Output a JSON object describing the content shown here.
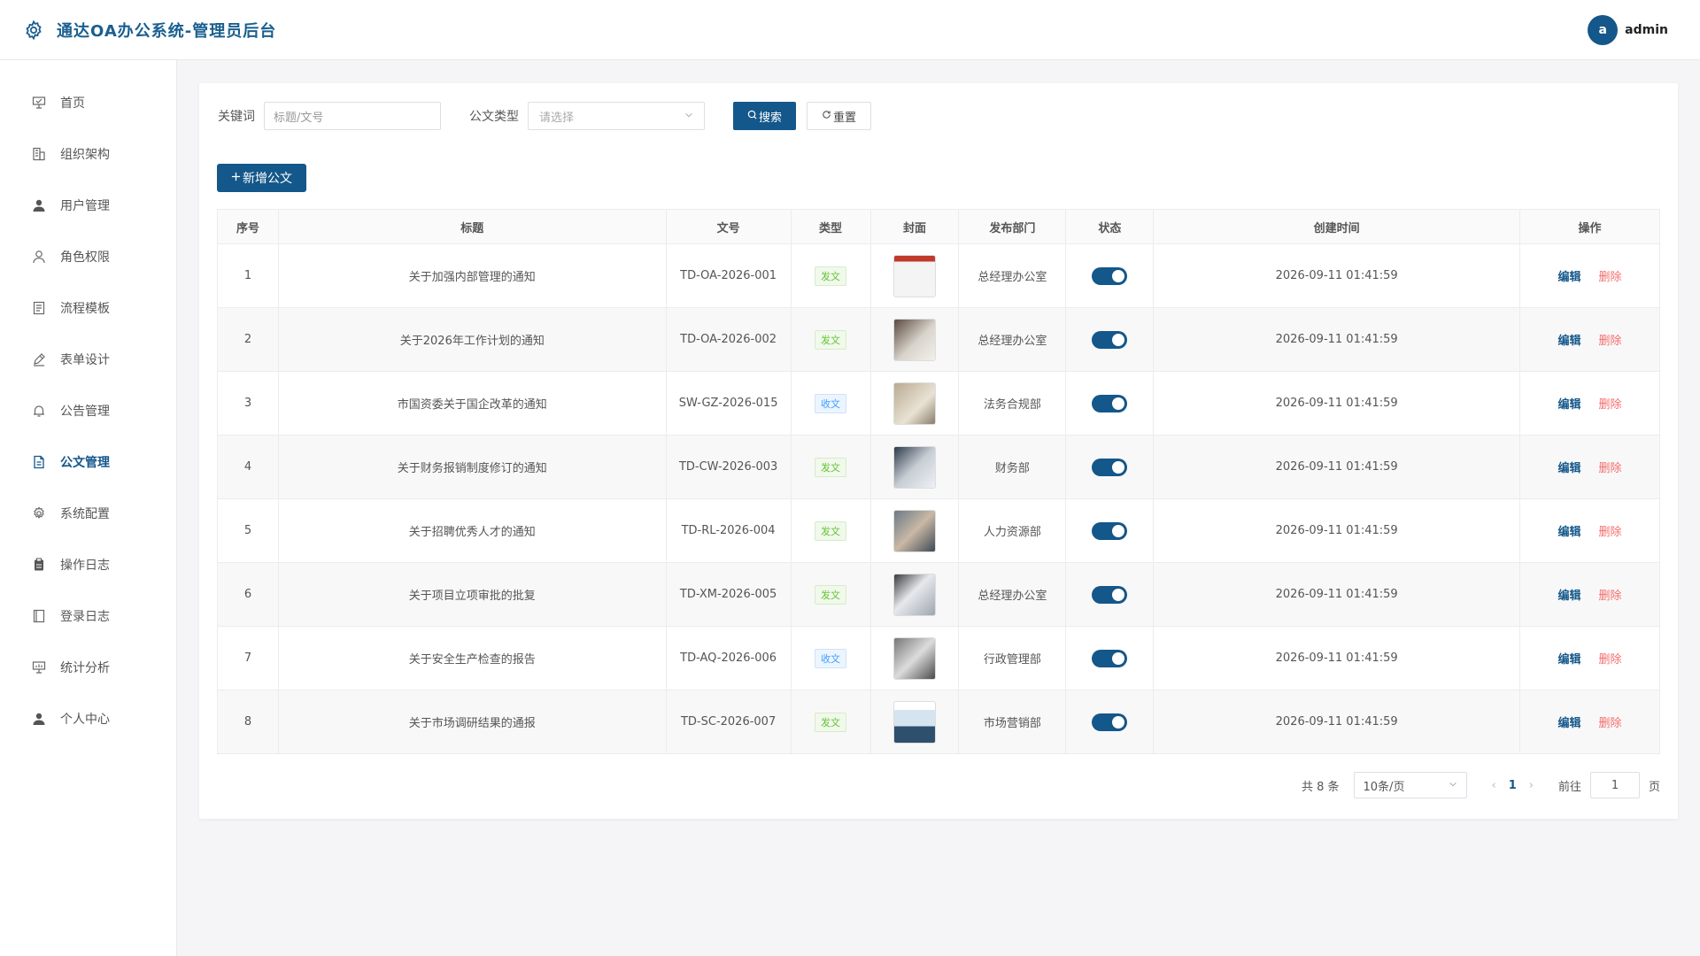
{
  "header": {
    "title": "通达OA办公系统-管理员后台",
    "user_initial": "a",
    "username": "admin"
  },
  "sidebar": {
    "items": [
      {
        "label": "首页",
        "icon": "presentation-icon"
      },
      {
        "label": "组织架构",
        "icon": "building-icon"
      },
      {
        "label": "用户管理",
        "icon": "user-icon"
      },
      {
        "label": "角色权限",
        "icon": "user-outline-icon"
      },
      {
        "label": "流程模板",
        "icon": "document-icon"
      },
      {
        "label": "表单设计",
        "icon": "pen-icon"
      },
      {
        "label": "公告管理",
        "icon": "bell-icon"
      },
      {
        "label": "公文管理",
        "icon": "file-icon",
        "active": true
      },
      {
        "label": "系统配置",
        "icon": "gear-icon"
      },
      {
        "label": "操作日志",
        "icon": "clipboard-icon"
      },
      {
        "label": "登录日志",
        "icon": "notebook-icon"
      },
      {
        "label": "统计分析",
        "icon": "chart-board-icon"
      },
      {
        "label": "个人中心",
        "icon": "user-icon"
      }
    ]
  },
  "filters": {
    "keyword_label": "关键词",
    "keyword_placeholder": "标题/文号",
    "type_label": "公文类型",
    "type_placeholder": "请选择",
    "search_label": "搜索",
    "reset_label": "重置"
  },
  "add_button_label": "新增公文",
  "table": {
    "headers": [
      "序号",
      "标题",
      "文号",
      "类型",
      "封面",
      "发布部门",
      "状态",
      "创建时间",
      "操作"
    ],
    "rows": [
      {
        "no": "1",
        "title": "关于加强内部管理的通知",
        "doc_no": "TD-OA-2026-001",
        "type": "发文",
        "dept": "总经理办公室",
        "created": "2026-09-11 01:41:59",
        "enabled": true
      },
      {
        "no": "2",
        "title": "关于2026年工作计划的通知",
        "doc_no": "TD-OA-2026-002",
        "type": "发文",
        "dept": "总经理办公室",
        "created": "2026-09-11 01:41:59",
        "enabled": true
      },
      {
        "no": "3",
        "title": "市国资委关于国企改革的通知",
        "doc_no": "SW-GZ-2026-015",
        "type": "收文",
        "dept": "法务合规部",
        "created": "2026-09-11 01:41:59",
        "enabled": true
      },
      {
        "no": "4",
        "title": "关于财务报销制度修订的通知",
        "doc_no": "TD-CW-2026-003",
        "type": "发文",
        "dept": "财务部",
        "created": "2026-09-11 01:41:59",
        "enabled": true
      },
      {
        "no": "5",
        "title": "关于招聘优秀人才的通知",
        "doc_no": "TD-RL-2026-004",
        "type": "发文",
        "dept": "人力资源部",
        "created": "2026-09-11 01:41:59",
        "enabled": true
      },
      {
        "no": "6",
        "title": "关于项目立项审批的批复",
        "doc_no": "TD-XM-2026-005",
        "type": "发文",
        "dept": "总经理办公室",
        "created": "2026-09-11 01:41:59",
        "enabled": true
      },
      {
        "no": "7",
        "title": "关于安全生产检查的报告",
        "doc_no": "TD-AQ-2026-006",
        "type": "收文",
        "dept": "行政管理部",
        "created": "2026-09-11 01:41:59",
        "enabled": true
      },
      {
        "no": "8",
        "title": "关于市场调研结果的通报",
        "doc_no": "TD-SC-2026-007",
        "type": "发文",
        "dept": "市场营销部",
        "created": "2026-09-11 01:41:59",
        "enabled": true
      }
    ],
    "edit_label": "编辑",
    "delete_label": "删除"
  },
  "pagination": {
    "total_text": "共 8 条",
    "page_size": "10条/页",
    "current_page": "1",
    "goto_label": "前往",
    "goto_value": "1",
    "page_suffix": "页"
  },
  "colors": {
    "primary": "#14578a",
    "danger": "#f56c6c",
    "send_tag": "#67c23a",
    "recv_tag": "#409eff"
  }
}
